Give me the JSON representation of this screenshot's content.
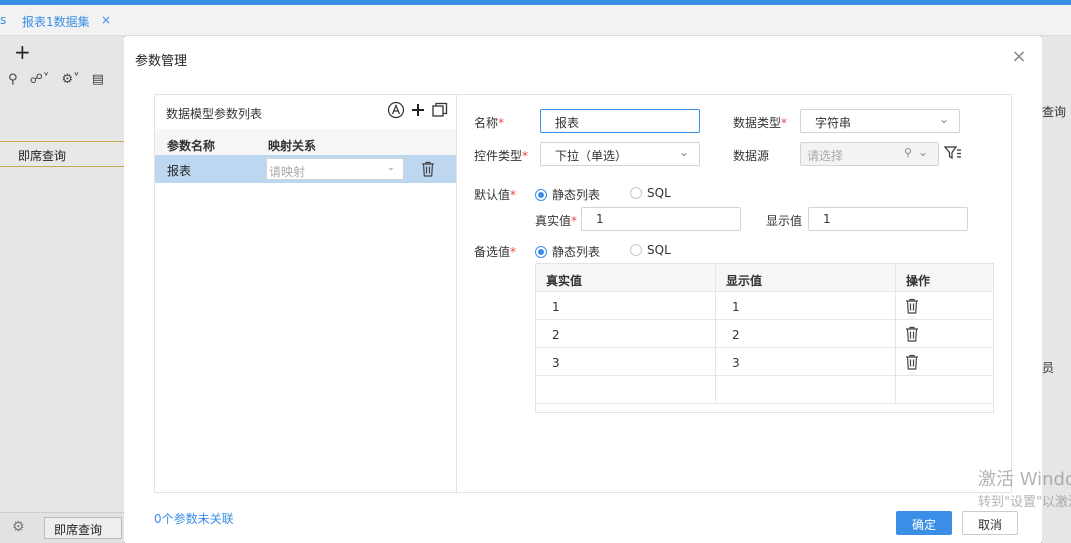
{
  "app": {
    "tab_fragment": "s",
    "tab_label": "报表1数据集",
    "tab_close": "×",
    "left_query": "即席查询",
    "bottom_tab": "即席查询",
    "right_text": "查询",
    "right_text2": "员"
  },
  "watermark": {
    "line1": "激活 Windows",
    "line2": "转到\"设置\"以激活"
  },
  "modal": {
    "title": "参数管理",
    "close": "×",
    "left": {
      "title": "数据模型参数列表",
      "col_name": "参数名称",
      "col_map": "映射关系",
      "rows": [
        {
          "name": "报表",
          "map_placeholder": "请映射"
        }
      ]
    },
    "form": {
      "name_label": "名称",
      "name_value": "报表",
      "data_type_label": "数据类型",
      "data_type_value": "字符串",
      "control_type_label": "控件类型",
      "control_type_value": "下拉（单选）",
      "data_source_label": "数据源",
      "data_source_placeholder": "请选择",
      "default_label": "默认值",
      "default_radio_static": "静态列表",
      "default_radio_sql": "SQL",
      "real_label": "真实值",
      "real_value": "1",
      "display_label": "显示值",
      "display_value": "1",
      "options_label": "备选值",
      "options_radio_static": "静态列表",
      "options_radio_sql": "SQL",
      "required_mark": "*"
    },
    "options_table": {
      "headers": [
        "真实值",
        "显示值",
        "操作"
      ],
      "rows": [
        {
          "real": "1",
          "display": "1"
        },
        {
          "real": "2",
          "display": "2"
        },
        {
          "real": "3",
          "display": "3"
        }
      ]
    },
    "footer": {
      "unlinked": "0个参数未关联",
      "ok": "确定",
      "cancel": "取消"
    }
  },
  "colors": {
    "accent": "#3a8ee6",
    "selected_row": "#bdd7f1",
    "required": "#e84a4a"
  }
}
